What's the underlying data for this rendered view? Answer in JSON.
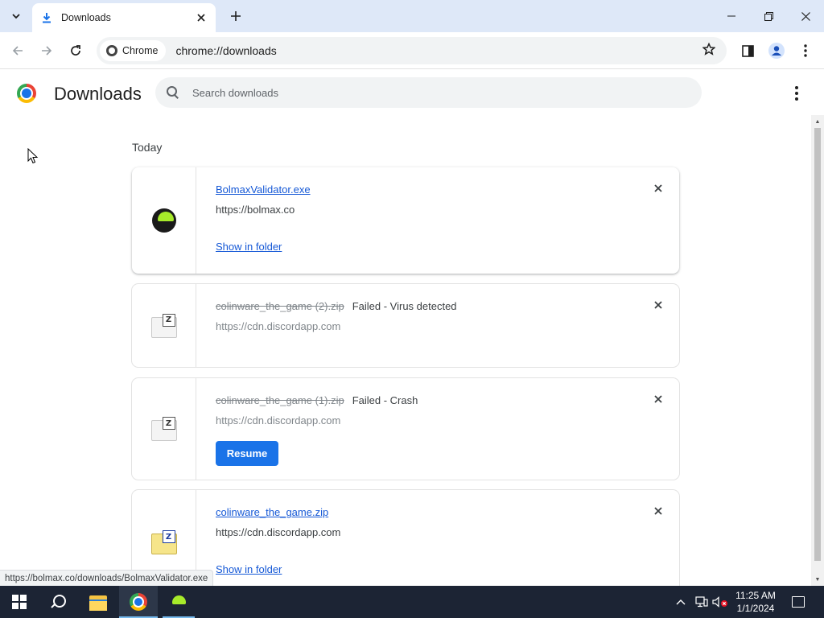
{
  "tabstrip": {
    "tab_title": "Downloads",
    "search_tabs_icon": "chevron-down-icon",
    "close_tab_icon": "close-icon",
    "new_tab_icon": "plus-icon"
  },
  "window_controls": {
    "minimize_icon": "minimize-icon",
    "restore_icon": "restore-icon",
    "close_icon": "close-icon"
  },
  "toolbar": {
    "chip_label": "Chrome",
    "url": "chrome://downloads"
  },
  "page": {
    "title": "Downloads",
    "search_placeholder": "Search downloads",
    "date_group": "Today"
  },
  "downloads": [
    {
      "filename": "BolmaxValidator.exe",
      "status": "",
      "url": "https://bolmax.co",
      "action": "Show in folder",
      "failed": false
    },
    {
      "filename": "colinware_the_game (2).zip",
      "status": "Failed - Virus detected",
      "url": "https://cdn.discordapp.com",
      "action": "",
      "failed": true
    },
    {
      "filename": "colinware_the_game (1).zip",
      "status": "Failed - Crash",
      "url": "https://cdn.discordapp.com",
      "action": "Resume",
      "failed": true
    },
    {
      "filename": "colinware_the_game.zip",
      "status": "",
      "url": "https://cdn.discordapp.com",
      "action": "Show in folder",
      "failed": false
    }
  ],
  "status_bar": {
    "hover_url": "https://bolmax.co/downloads/BolmaxValidator.exe"
  },
  "taskbar": {
    "time": "11:25 AM",
    "date": "1/1/2024"
  },
  "colors": {
    "accent": "#1a73e8",
    "link": "#1558d6",
    "tabstrip": "#dee8f8",
    "taskbar": "#1c2434"
  }
}
